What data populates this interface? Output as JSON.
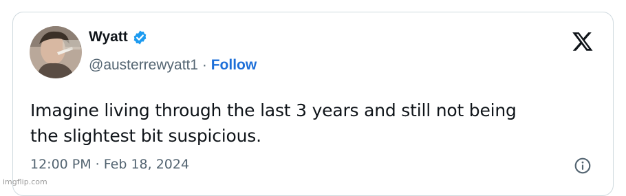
{
  "tweet": {
    "author_name": "Wyatt",
    "handle": "@austerrewyatt1",
    "separator": "·",
    "follow_label": "Follow",
    "text_line1": "Imagine living through the last 3 years and still not being",
    "text_line2": "the slightest bit suspicious.",
    "timestamp": "12:00 PM · Feb 18, 2024",
    "verified_icon": "verified-badge-icon",
    "platform_icon": "x-logo-icon",
    "info_icon": "info-icon"
  },
  "watermark": "imgflip.com",
  "colors": {
    "text": "#0f1419",
    "secondary": "#536471",
    "link": "#1d6fd8",
    "verified": "#1d9bf0",
    "border": "#cfd9de"
  }
}
